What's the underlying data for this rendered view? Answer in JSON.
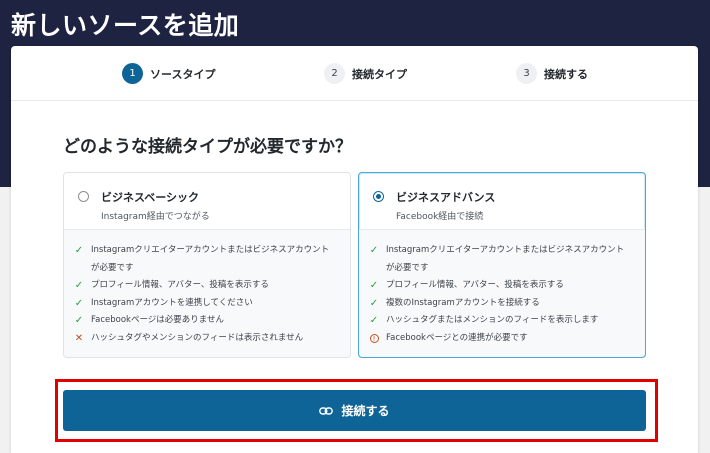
{
  "page": {
    "title": "新しいソースを追加"
  },
  "steps": [
    {
      "num": "1",
      "label": "ソースタイプ",
      "active": true
    },
    {
      "num": "2",
      "label": "接続タイプ",
      "active": false
    },
    {
      "num": "3",
      "label": "接続する",
      "active": false
    }
  ],
  "question": "どのような接続タイプが必要ですか？",
  "cards": [
    {
      "title": "ビジネスベーシック",
      "subtitle": "Instagram経由でつながる",
      "selected": false,
      "features": [
        {
          "icon": "check-icon",
          "text": "Instagramクリエイターアカウントまたはビジネスアカウント"
        },
        {
          "icon": "",
          "text": "が必要です"
        },
        {
          "icon": "check-icon",
          "text": "プロフィール情報、アバター、投稿を表示する"
        },
        {
          "icon": "check-icon",
          "text": "Instagramアカウントを連携してください"
        },
        {
          "icon": "check-icon",
          "text": "Facebookページは必要ありません"
        },
        {
          "icon": "cross-icon",
          "text": "ハッシュタグやメンションのフィードは表示されません"
        }
      ]
    },
    {
      "title": "ビジネスアドバンス",
      "subtitle": "Facebook経由で接続",
      "selected": true,
      "features": [
        {
          "icon": "check-icon",
          "text": "Instagramクリエイターアカウントまたはビジネスアカウント"
        },
        {
          "icon": "",
          "text": "が必要です"
        },
        {
          "icon": "check-icon",
          "text": "プロフィール情報、アバター、投稿を表示する"
        },
        {
          "icon": "check-icon",
          "text": "複数のInstagramアカウントを接続する"
        },
        {
          "icon": "check-icon",
          "text": "ハッシュタグまたはメンションのフィードを表示します"
        },
        {
          "icon": "info-icon",
          "text": "Facebookページとの連携が必要です"
        }
      ]
    }
  ],
  "connect_button": {
    "label": "接続する",
    "icon": "link-icon"
  },
  "colors": {
    "header_bg": "#1d2340",
    "primary": "#0f6497",
    "check": "#2a9d3f",
    "warning": "#c0521e",
    "highlight": "#e00000"
  }
}
